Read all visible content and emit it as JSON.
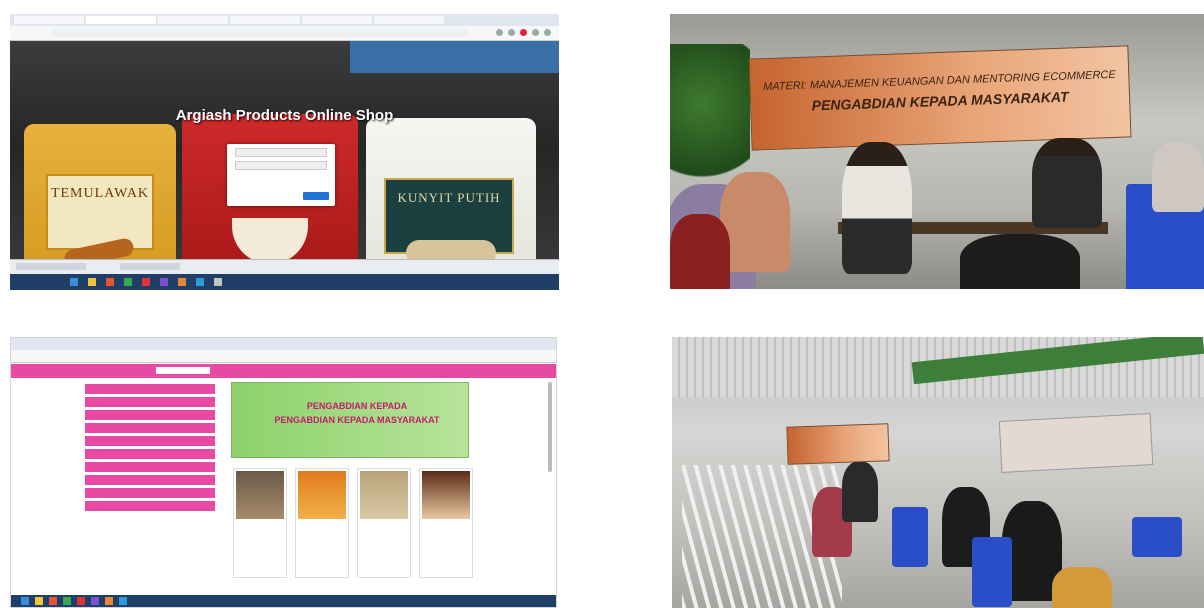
{
  "panel_shop": {
    "title": "Argiash Products Online Shop",
    "products": [
      "TEMULAWAK",
      "KUNYIT PUTIH"
    ]
  },
  "panel_meeting": {
    "banner_line1": "MATERI: MANAJEMEN KEUANGAN DAN MENTORING ECOMMERCE",
    "banner_line2": "PENGABDIAN KEPADA MASYARAKAT"
  },
  "panel_website": {
    "promo_line1": "PENGABDIAN KEPADA",
    "promo_line2": "PENGABDIAN KEPADA MASYARAKAT"
  },
  "colors": {
    "website_pink": "#e84aa3",
    "banner_orange": "#c6642f"
  }
}
